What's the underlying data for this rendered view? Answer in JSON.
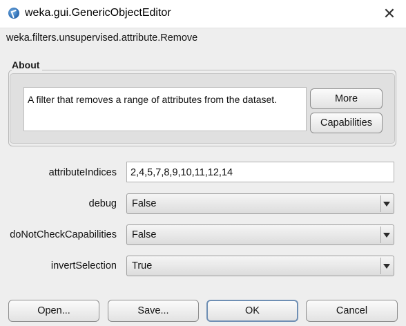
{
  "window": {
    "title": "weka.gui.GenericObjectEditor",
    "icon": "weka-icon",
    "close": "✕"
  },
  "classname": "weka.filters.unsupervised.attribute.Remove",
  "about": {
    "label": "About",
    "text": "A filter that removes a range of attributes from the dataset.",
    "more_label": "More",
    "capabilities_label": "Capabilities"
  },
  "properties": {
    "attributeIndices": {
      "label": "attributeIndices",
      "value": "2,4,5,7,8,9,10,11,12,14"
    },
    "debug": {
      "label": "debug",
      "value": "False"
    },
    "doNotCheckCapabilities": {
      "label": "doNotCheckCapabilities",
      "value": "False"
    },
    "invertSelection": {
      "label": "invertSelection",
      "value": "True"
    }
  },
  "buttons": {
    "open": "Open...",
    "save": "Save...",
    "ok": "OK",
    "cancel": "Cancel"
  }
}
